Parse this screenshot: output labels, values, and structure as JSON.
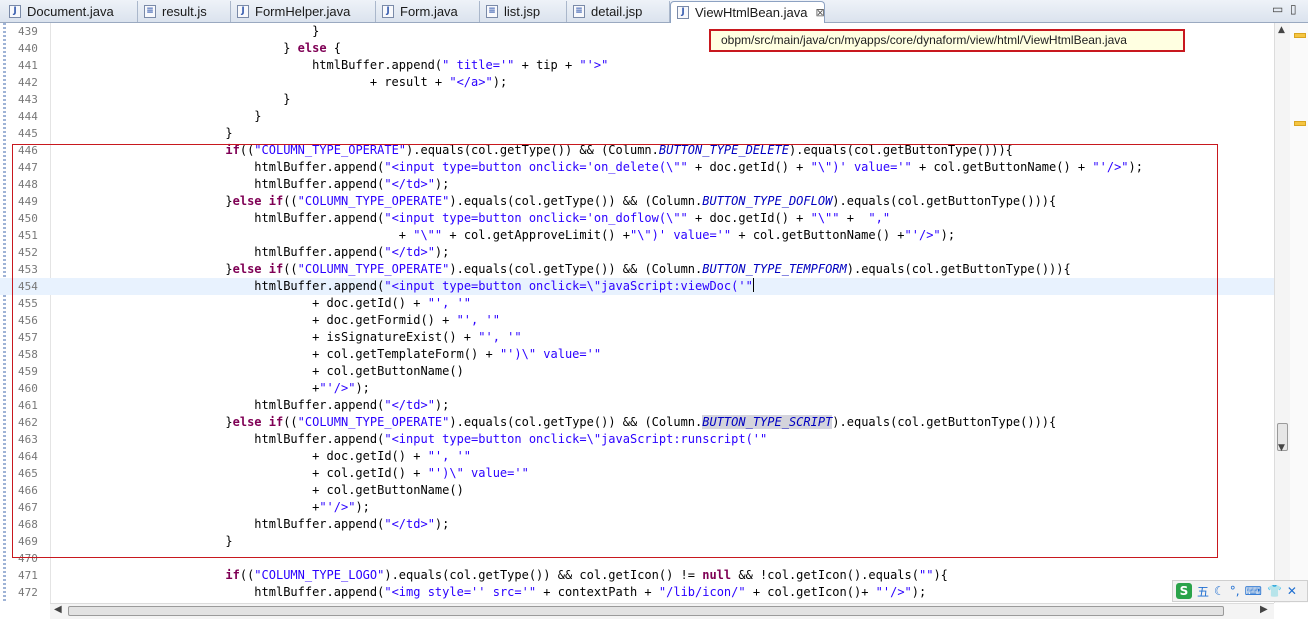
{
  "tabs": [
    {
      "label": "Document.java",
      "icon": "java-file-icon",
      "glyph": "J"
    },
    {
      "label": "result.js",
      "icon": "js-file-icon",
      "glyph": "≡"
    },
    {
      "label": "FormHelper.java",
      "icon": "java-file-icon",
      "glyph": "J"
    },
    {
      "label": "Form.java",
      "icon": "java-file-icon",
      "glyph": "J"
    },
    {
      "label": "list.jsp",
      "icon": "jsp-file-icon",
      "glyph": "≡"
    },
    {
      "label": "detail.jsp",
      "icon": "jsp-file-icon",
      "glyph": "≡"
    },
    {
      "label": "ViewHtmlBean.java",
      "icon": "java-file-icon",
      "glyph": "J",
      "active": true,
      "close": "⊠"
    }
  ],
  "window": {
    "minimize": "▭",
    "maximize": "▯"
  },
  "tooltip": "obpm/src/main/java/cn/myapps/core/dynaform/view/html/ViewHtmlBean.java",
  "lines": [
    {
      "n": "439",
      "c": [
        [
          "",
          "                                    }"
        ]
      ]
    },
    {
      "n": "440",
      "c": [
        [
          "",
          "                                } "
        ],
        [
          "kw",
          "else"
        ],
        [
          "",
          " {"
        ]
      ]
    },
    {
      "n": "441",
      "c": [
        [
          "",
          "                                    htmlBuffer.append("
        ],
        [
          "str",
          "\" title='\""
        ],
        [
          "",
          " + tip + "
        ],
        [
          "str",
          "\"'>\""
        ]
      ]
    },
    {
      "n": "442",
      "c": [
        [
          "",
          "                                            + result + "
        ],
        [
          "str",
          "\"</a>\""
        ],
        [
          "",
          ");"
        ]
      ]
    },
    {
      "n": "443",
      "c": [
        [
          "",
          "                                }"
        ]
      ]
    },
    {
      "n": "444",
      "c": [
        [
          "",
          "                            }"
        ]
      ]
    },
    {
      "n": "445",
      "c": [
        [
          "",
          "                        }"
        ]
      ]
    },
    {
      "n": "446",
      "c": [
        [
          "",
          "                        "
        ],
        [
          "kw",
          "if"
        ],
        [
          "",
          "(("
        ],
        [
          "str",
          "\"COLUMN_TYPE_OPERATE\""
        ],
        [
          "",
          ").equals(col.getType()) && (Column."
        ],
        [
          "it",
          "BUTTON_TYPE_DELETE"
        ],
        [
          "",
          ").equals(col.getButtonType())){"
        ]
      ]
    },
    {
      "n": "447",
      "c": [
        [
          "",
          "                            htmlBuffer.append("
        ],
        [
          "str",
          "\"<input type=button onclick='on_delete(\\\"\""
        ],
        [
          "",
          " + doc.getId() + "
        ],
        [
          "str",
          "\"\\\")' value='\""
        ],
        [
          "",
          " + col.getButtonName() + "
        ],
        [
          "str",
          "\"'/>\""
        ],
        [
          "",
          ");"
        ]
      ]
    },
    {
      "n": "448",
      "c": [
        [
          "",
          "                            htmlBuffer.append("
        ],
        [
          "str",
          "\"</td>\""
        ],
        [
          "",
          ");"
        ]
      ]
    },
    {
      "n": "449",
      "c": [
        [
          "",
          "                        }"
        ],
        [
          "kw",
          "else if"
        ],
        [
          "",
          "(("
        ],
        [
          "str",
          "\"COLUMN_TYPE_OPERATE\""
        ],
        [
          "",
          ").equals(col.getType()) && (Column."
        ],
        [
          "it",
          "BUTTON_TYPE_DOFLOW"
        ],
        [
          "",
          ").equals(col.getButtonType())){"
        ]
      ]
    },
    {
      "n": "450",
      "c": [
        [
          "",
          "                            htmlBuffer.append("
        ],
        [
          "str",
          "\"<input type=button onclick='on_doflow(\\\"\""
        ],
        [
          "",
          " + doc.getId() + "
        ],
        [
          "str",
          "\"\\\"\""
        ],
        [
          "",
          " +  "
        ],
        [
          "str",
          "\",\""
        ]
      ]
    },
    {
      "n": "451",
      "c": [
        [
          "",
          "                                                + "
        ],
        [
          "str",
          "\"\\\"\""
        ],
        [
          "",
          " + col.getApproveLimit() +"
        ],
        [
          "str",
          "\"\\\")' value='\""
        ],
        [
          "",
          " + col.getButtonName() +"
        ],
        [
          "str",
          "\"'/>\""
        ],
        [
          "",
          ");"
        ]
      ]
    },
    {
      "n": "452",
      "c": [
        [
          "",
          "                            htmlBuffer.append("
        ],
        [
          "str",
          "\"</td>\""
        ],
        [
          "",
          ");"
        ]
      ]
    },
    {
      "n": "453",
      "c": [
        [
          "",
          "                        }"
        ],
        [
          "kw",
          "else if"
        ],
        [
          "",
          "(("
        ],
        [
          "str",
          "\"COLUMN_TYPE_OPERATE\""
        ],
        [
          "",
          ").equals(col.getType()) && (Column."
        ],
        [
          "it",
          "BUTTON_TYPE_TEMPFORM"
        ],
        [
          "",
          ").equals(col.getButtonType())){"
        ]
      ]
    },
    {
      "n": "454",
      "cur": true,
      "c": [
        [
          "",
          "                            htmlBuffer.append("
        ],
        [
          "str",
          "\"<input type=button onclick=\\\"javaScript:viewDoc('\""
        ]
      ]
    },
    {
      "n": "455",
      "c": [
        [
          "",
          "                                    + doc.getId() + "
        ],
        [
          "str",
          "\"', '\""
        ]
      ]
    },
    {
      "n": "456",
      "c": [
        [
          "",
          "                                    + doc.getFormid() + "
        ],
        [
          "str",
          "\"', '\""
        ]
      ]
    },
    {
      "n": "457",
      "c": [
        [
          "",
          "                                    + isSignatureExist() + "
        ],
        [
          "str",
          "\"', '\""
        ]
      ]
    },
    {
      "n": "458",
      "c": [
        [
          "",
          "                                    + col.getTemplateForm() + "
        ],
        [
          "str",
          "\"')\\\" value='\""
        ]
      ]
    },
    {
      "n": "459",
      "c": [
        [
          "",
          "                                    + col.getButtonName()"
        ]
      ]
    },
    {
      "n": "460",
      "c": [
        [
          "",
          "                                    +"
        ],
        [
          "str",
          "\"'/>\""
        ],
        [
          "",
          ");"
        ]
      ]
    },
    {
      "n": "461",
      "c": [
        [
          "",
          "                            htmlBuffer.append("
        ],
        [
          "str",
          "\"</td>\""
        ],
        [
          "",
          ");"
        ]
      ]
    },
    {
      "n": "462",
      "c": [
        [
          "",
          "                        }"
        ],
        [
          "kw",
          "else if"
        ],
        [
          "",
          "(("
        ],
        [
          "str",
          "\"COLUMN_TYPE_OPERATE\""
        ],
        [
          "",
          ").equals(col.getType()) && (Column."
        ],
        [
          "it hl",
          "BUTTON_TYPE_SCRIPT"
        ],
        [
          "",
          ").equals(col.getButtonType())){"
        ]
      ]
    },
    {
      "n": "463",
      "c": [
        [
          "",
          "                            htmlBuffer.append("
        ],
        [
          "str",
          "\"<input type=button onclick=\\\"javaScript:runscript('\""
        ]
      ]
    },
    {
      "n": "464",
      "c": [
        [
          "",
          "                                    + doc.getId() + "
        ],
        [
          "str",
          "\"', '\""
        ]
      ]
    },
    {
      "n": "465",
      "c": [
        [
          "",
          "                                    + col.getId() + "
        ],
        [
          "str",
          "\"')\\\" value='\""
        ]
      ]
    },
    {
      "n": "466",
      "c": [
        [
          "",
          "                                    + col.getButtonName()"
        ]
      ]
    },
    {
      "n": "467",
      "c": [
        [
          "",
          "                                    +"
        ],
        [
          "str",
          "\"'/>\""
        ],
        [
          "",
          ");"
        ]
      ]
    },
    {
      "n": "468",
      "c": [
        [
          "",
          "                            htmlBuffer.append("
        ],
        [
          "str",
          "\"</td>\""
        ],
        [
          "",
          ");"
        ]
      ]
    },
    {
      "n": "469",
      "c": [
        [
          "",
          "                        }"
        ]
      ]
    },
    {
      "n": "470",
      "c": [
        [
          "",
          ""
        ]
      ]
    },
    {
      "n": "471",
      "c": [
        [
          "",
          "                        "
        ],
        [
          "kw",
          "if"
        ],
        [
          "",
          "(("
        ],
        [
          "str",
          "\"COLUMN_TYPE_LOGO\""
        ],
        [
          "",
          ").equals(col.getType()) && col.getIcon() != "
        ],
        [
          "kw",
          "null"
        ],
        [
          "",
          " && !col.getIcon().equals("
        ],
        [
          "str",
          "\"\""
        ],
        [
          "",
          "){"
        ]
      ]
    },
    {
      "n": "472",
      "c": [
        [
          "",
          "                            htmlBuffer.append("
        ],
        [
          "str",
          "\"<img style='' src='\""
        ],
        [
          "",
          " + contextPath + "
        ],
        [
          "str",
          "\"/lib/icon/\""
        ],
        [
          "",
          " + col.getIcon()+ "
        ],
        [
          "str",
          "\"'/>\""
        ],
        [
          "",
          ");"
        ]
      ]
    }
  ],
  "ime": {
    "logo": "S",
    "mode": "五",
    "items": [
      "☾",
      "°,",
      "⌨",
      "👕",
      "✕"
    ]
  },
  "scroll": {
    "up": "▲",
    "down": "▼",
    "left": "◀",
    "right": "▶"
  },
  "colors": {
    "keyword": "#7f0055",
    "string": "#2a00ff",
    "constant": "#0000c0",
    "annotation_box": "#c8181e",
    "current_line": "#e8f2fe"
  }
}
